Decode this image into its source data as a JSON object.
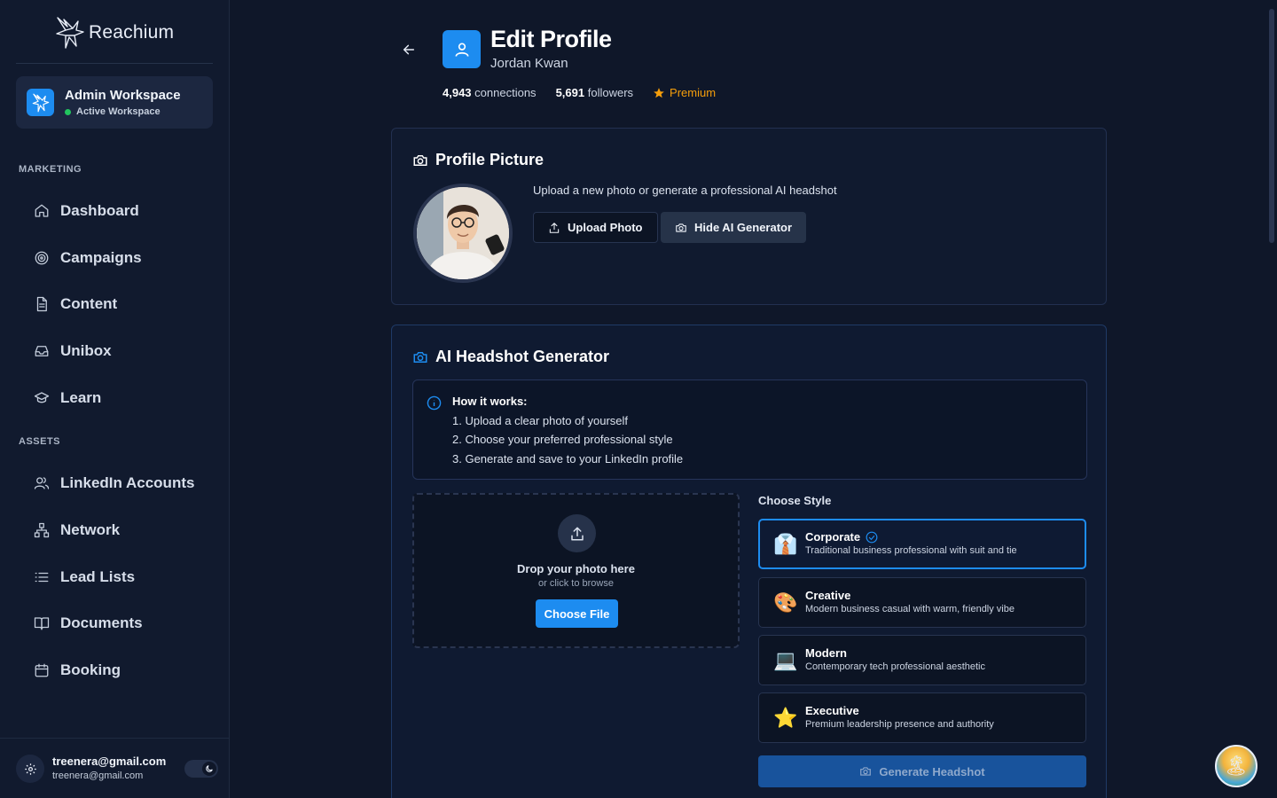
{
  "brand": {
    "name": "Reachium"
  },
  "workspace": {
    "title": "Admin Workspace",
    "status": "Active Workspace"
  },
  "sidebar": {
    "sections": [
      {
        "label": "MARKETING"
      },
      {
        "label": "ASSETS"
      }
    ],
    "items": [
      {
        "label": "Dashboard",
        "icon": "home-icon"
      },
      {
        "label": "Campaigns",
        "icon": "target-icon"
      },
      {
        "label": "Content",
        "icon": "document-icon"
      },
      {
        "label": "Unibox",
        "icon": "inbox-icon"
      },
      {
        "label": "Learn",
        "icon": "graduation-cap-icon"
      },
      {
        "label": "LinkedIn Accounts",
        "icon": "users-icon"
      },
      {
        "label": "Network",
        "icon": "network-icon"
      },
      {
        "label": "Lead Lists",
        "icon": "list-icon"
      },
      {
        "label": "Documents",
        "icon": "book-icon"
      },
      {
        "label": "Booking",
        "icon": "calendar-icon"
      }
    ]
  },
  "user": {
    "email": "treenera@gmail.com",
    "email_sub": "treenera@gmail.com"
  },
  "header": {
    "title": "Edit Profile",
    "subtitle": "Jordan Kwan",
    "connections_count": "4,943",
    "connections_label": "connections",
    "followers_count": "5,691",
    "followers_label": "followers",
    "badge": "Premium"
  },
  "profile_picture": {
    "title": "Profile Picture",
    "hint": "Upload a new photo or generate a professional AI headshot",
    "upload_label": "Upload Photo",
    "hide_ai_label": "Hide AI Generator"
  },
  "ai_generator": {
    "title": "AI Headshot Generator",
    "how_title": "How it works:",
    "steps": [
      "1. Upload a clear photo of yourself",
      "2. Choose your preferred professional style",
      "3. Generate and save to your LinkedIn profile"
    ],
    "dropzone": {
      "title": "Drop your photo here",
      "sub": "or click to browse",
      "button": "Choose File"
    },
    "style_label": "Choose Style",
    "styles": [
      {
        "name": "Corporate",
        "desc": "Traditional business professional with suit and tie",
        "emoji": "👔",
        "selected": true
      },
      {
        "name": "Creative",
        "desc": "Modern business casual with warm, friendly vibe",
        "emoji": "🎨",
        "selected": false
      },
      {
        "name": "Modern",
        "desc": "Contemporary tech professional aesthetic",
        "emoji": "💻",
        "selected": false
      },
      {
        "name": "Executive",
        "desc": "Premium leadership presence and authority",
        "emoji": "⭐",
        "selected": false
      }
    ],
    "generate_label": "Generate Headshot"
  },
  "colors": {
    "accent": "#1d8cf0",
    "premium": "#f59e0b",
    "background": "#0f1729",
    "sidebar": "#111a2e"
  }
}
